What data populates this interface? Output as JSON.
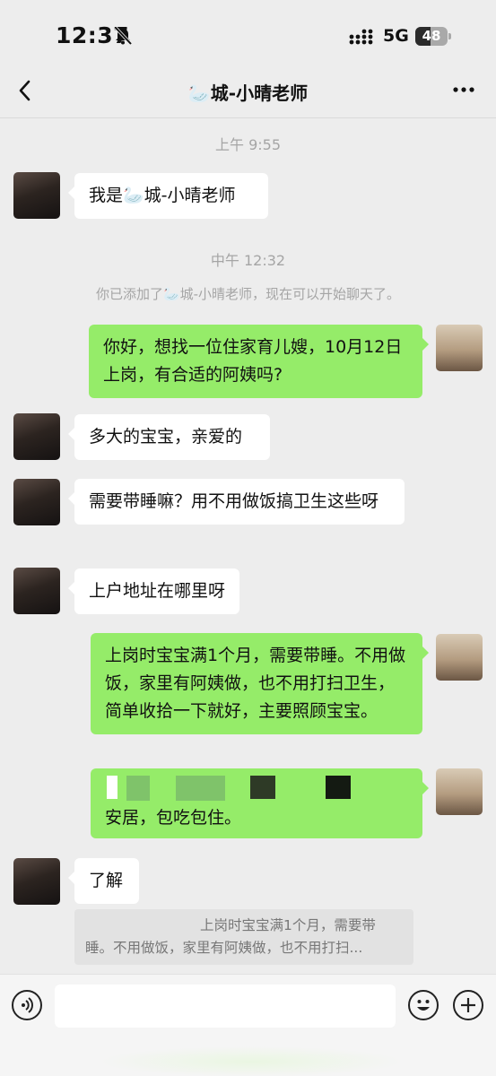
{
  "status_bar": {
    "time": "12:37",
    "network": "5G",
    "battery": "48",
    "battery_level": 0.48
  },
  "nav": {
    "title": "🦢城-小晴老师"
  },
  "chat": {
    "time_1": "上午 9:55",
    "msg_1": "我是🦢城-小晴老师",
    "time_2": "中午 12:32",
    "system_note": "你已添加了🦢城-小晴老师，现在可以开始聊天了。",
    "msg_2": "你好，想找一位住家育儿嫂，10月12日上岗，有合适的阿姨吗?",
    "msg_3": "多大的宝宝，亲爱的",
    "msg_4": "需要带睡嘛？用不用做饭搞卫生这些呀",
    "msg_5": "上户地址在哪里呀",
    "msg_6": "上岗时宝宝满1个月，需要带睡。不用做饭，家里有阿姨做，也不用打扫卫生，简单收拾一下就好，主要照顾宝宝。",
    "msg_7": "安居，包吃包住。",
    "msg_8": "了解",
    "quote": "上岗时宝宝满1个月，需要带睡。不用做饭，家里有阿姨做，也不用打扫..."
  },
  "icons": {
    "back": "chevron-left-icon",
    "more": "more-horizontal-icon",
    "voice": "voice-icon",
    "emoji": "smiley-icon",
    "plus": "plus-circle-icon",
    "mute": "bell-off-icon"
  },
  "colors": {
    "background": "#ededed",
    "outgoing_bubble": "#95ec69",
    "incoming_bubble": "#ffffff",
    "muted_text": "#a5a5a5"
  }
}
